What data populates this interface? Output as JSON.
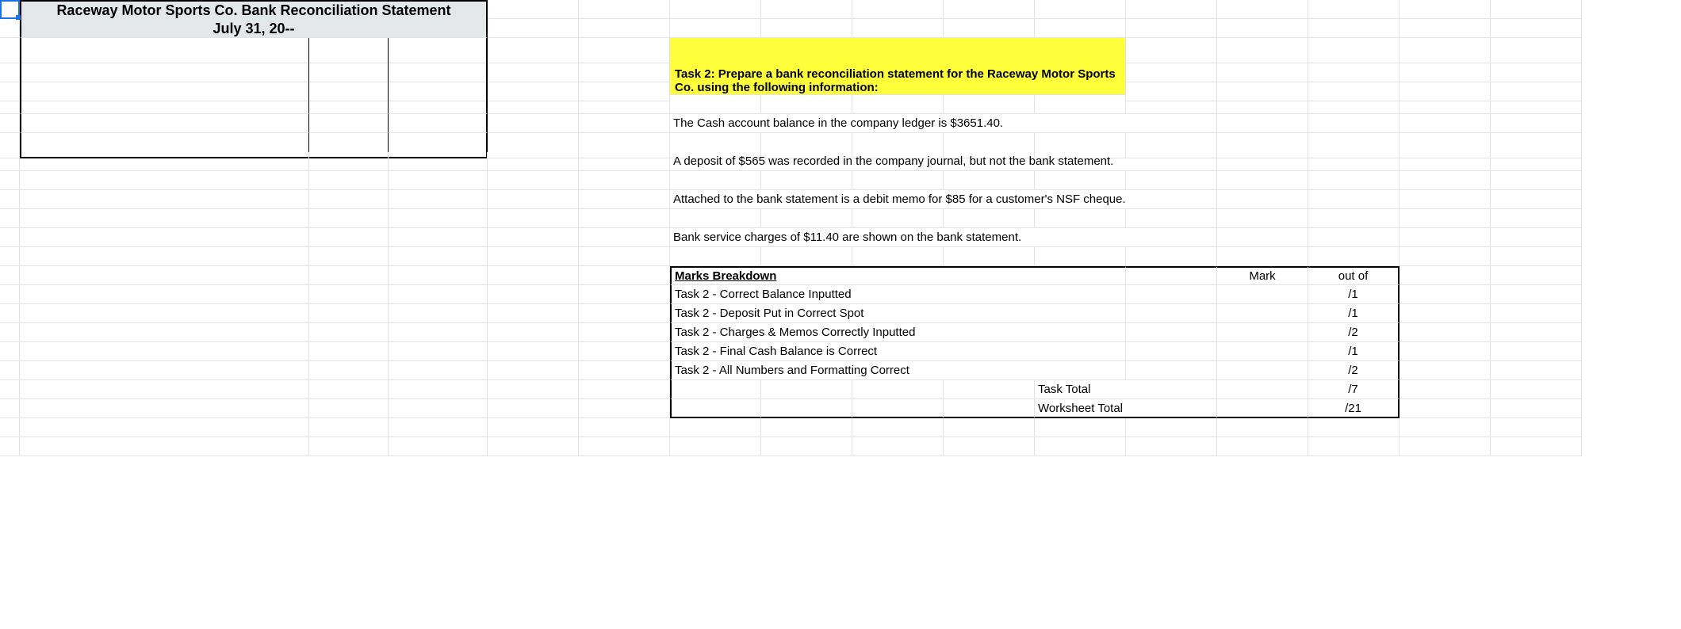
{
  "title_line1": "Raceway Motor Sports Co. Bank Reconciliation Statement",
  "title_line2": "July 31, 20--",
  "task_heading": "Task 2: Prepare a bank reconciliation statement for the Raceway Motor Sports Co. using the following information:",
  "info1": "The Cash account balance in the company ledger is $3651.40.",
  "info2": "A deposit of $565 was recorded in the company journal, but not the bank statement.",
  "info3": "Attached to the bank statement is a debit memo for $85 for a customer's NSF cheque.",
  "info4": "Bank service charges of $11.40 are shown on the bank statement.",
  "marks_breakdown": "Marks Breakdown",
  "mark_header": "Mark",
  "outof_header": "out of",
  "rows": {
    "r1": "Task 2 - Correct Balance Inputted",
    "r2": "Task 2 - Deposit Put in Correct Spot",
    "r3": "Task 2 - Charges & Memos Correctly Inputted",
    "r4": "Task 2 - Final Cash Balance is Correct",
    "r5": "Task 2 - All Numbers and Formatting Correct",
    "task_total": "Task Total",
    "worksheet_total": "Worksheet Total"
  },
  "outof": {
    "r1": "/1",
    "r2": "/1",
    "r3": "/2",
    "r4": "/1",
    "r5": "/2",
    "task_total": "/7",
    "worksheet_total": "/21"
  }
}
